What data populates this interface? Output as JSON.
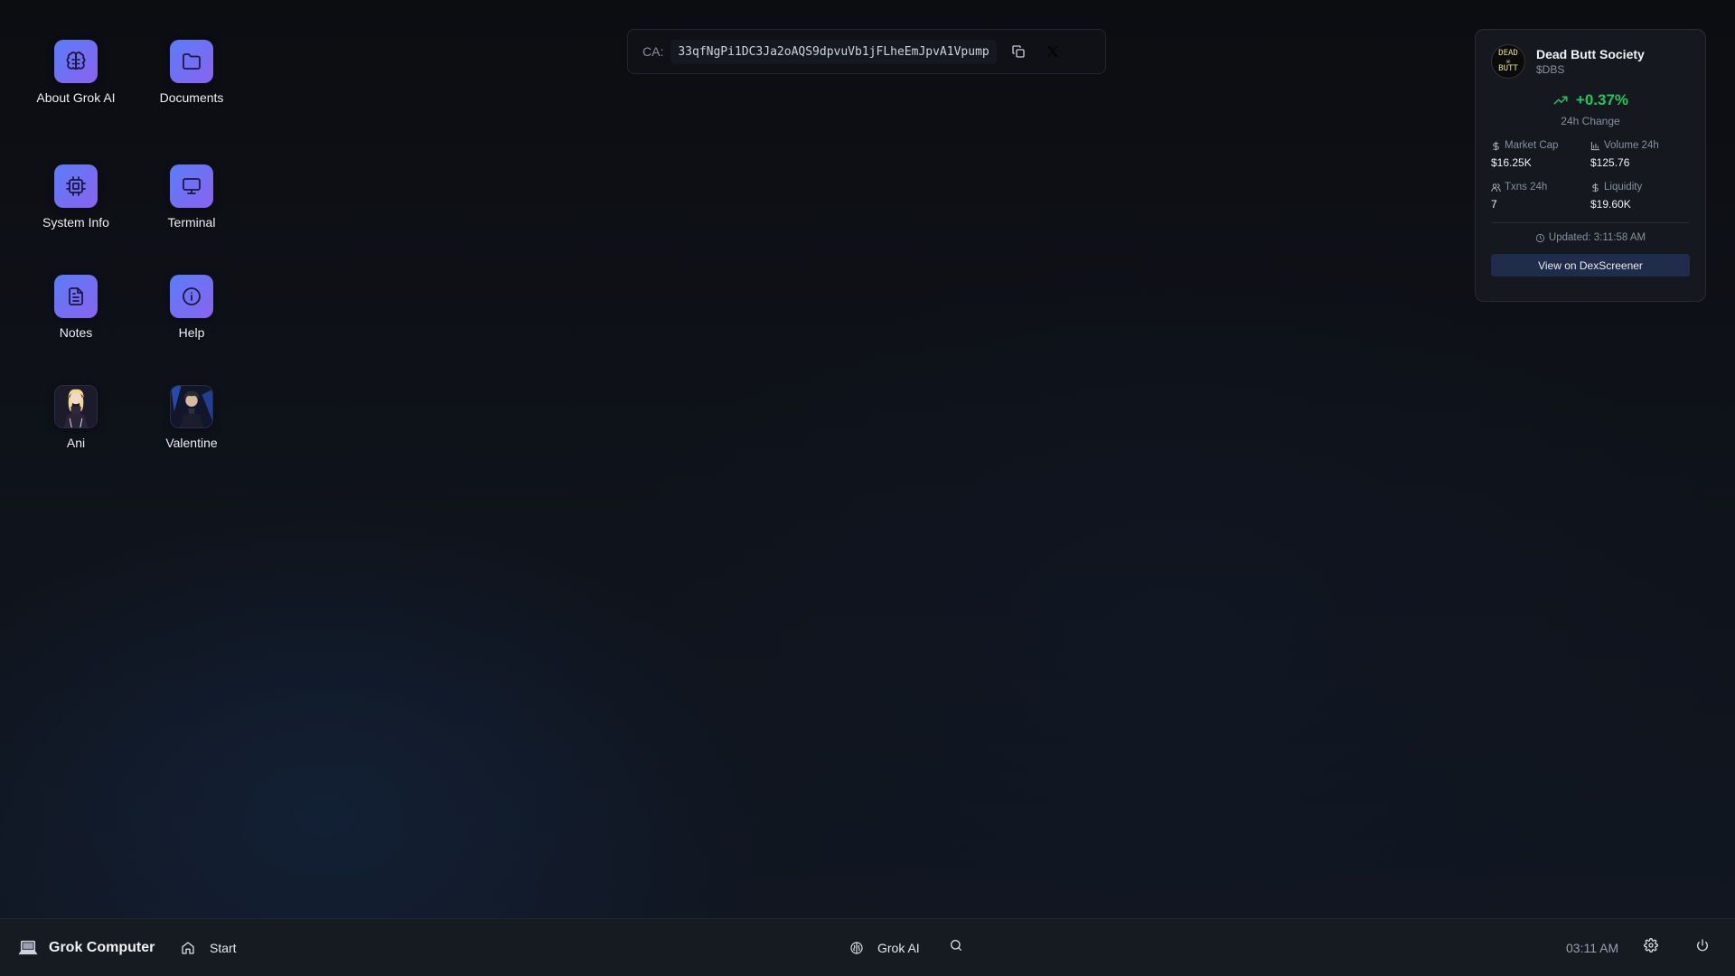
{
  "desktop": {
    "icons": [
      {
        "label": "About Grok AI",
        "icon": "brain-icon"
      },
      {
        "label": "Documents",
        "icon": "folder-icon"
      },
      {
        "label": "System Info",
        "icon": "cpu-icon"
      },
      {
        "label": "Terminal",
        "icon": "monitor-icon"
      },
      {
        "label": "Notes",
        "icon": "file-text-icon"
      },
      {
        "label": "Help",
        "icon": "info-icon"
      },
      {
        "label": "Ani",
        "icon": "ani-avatar"
      },
      {
        "label": "Valentine",
        "icon": "valentine-avatar"
      }
    ]
  },
  "ca_bar": {
    "label": "CA:",
    "address": "33qfNgPi1DC3Ja2oAQS9dpvuVb1jFLheEmJpvA1Vpump"
  },
  "token": {
    "logo_text_top": "DEAD",
    "logo_text_bottom": "BUTT",
    "name": "Dead Butt Society",
    "symbol": "$DBS",
    "change": "+0.37%",
    "change_label": "24h Change",
    "change_color": "#22c55e",
    "stats": [
      {
        "label": "Market Cap",
        "value": "$16.25K",
        "icon": "dollar-icon"
      },
      {
        "label": "Volume 24h",
        "value": "$125.76",
        "icon": "bar-chart-icon"
      },
      {
        "label": "Txns 24h",
        "value": "7",
        "icon": "users-icon"
      },
      {
        "label": "Liquidity",
        "value": "$19.60K",
        "icon": "dollar-icon"
      }
    ],
    "updated": "Updated: 3:11:58 AM",
    "button_label": "View on DexScreener"
  },
  "taskbar": {
    "brand": "Grok Computer",
    "start_label": "Start",
    "grok_label": "Grok AI",
    "clock": "03:11 AM"
  }
}
